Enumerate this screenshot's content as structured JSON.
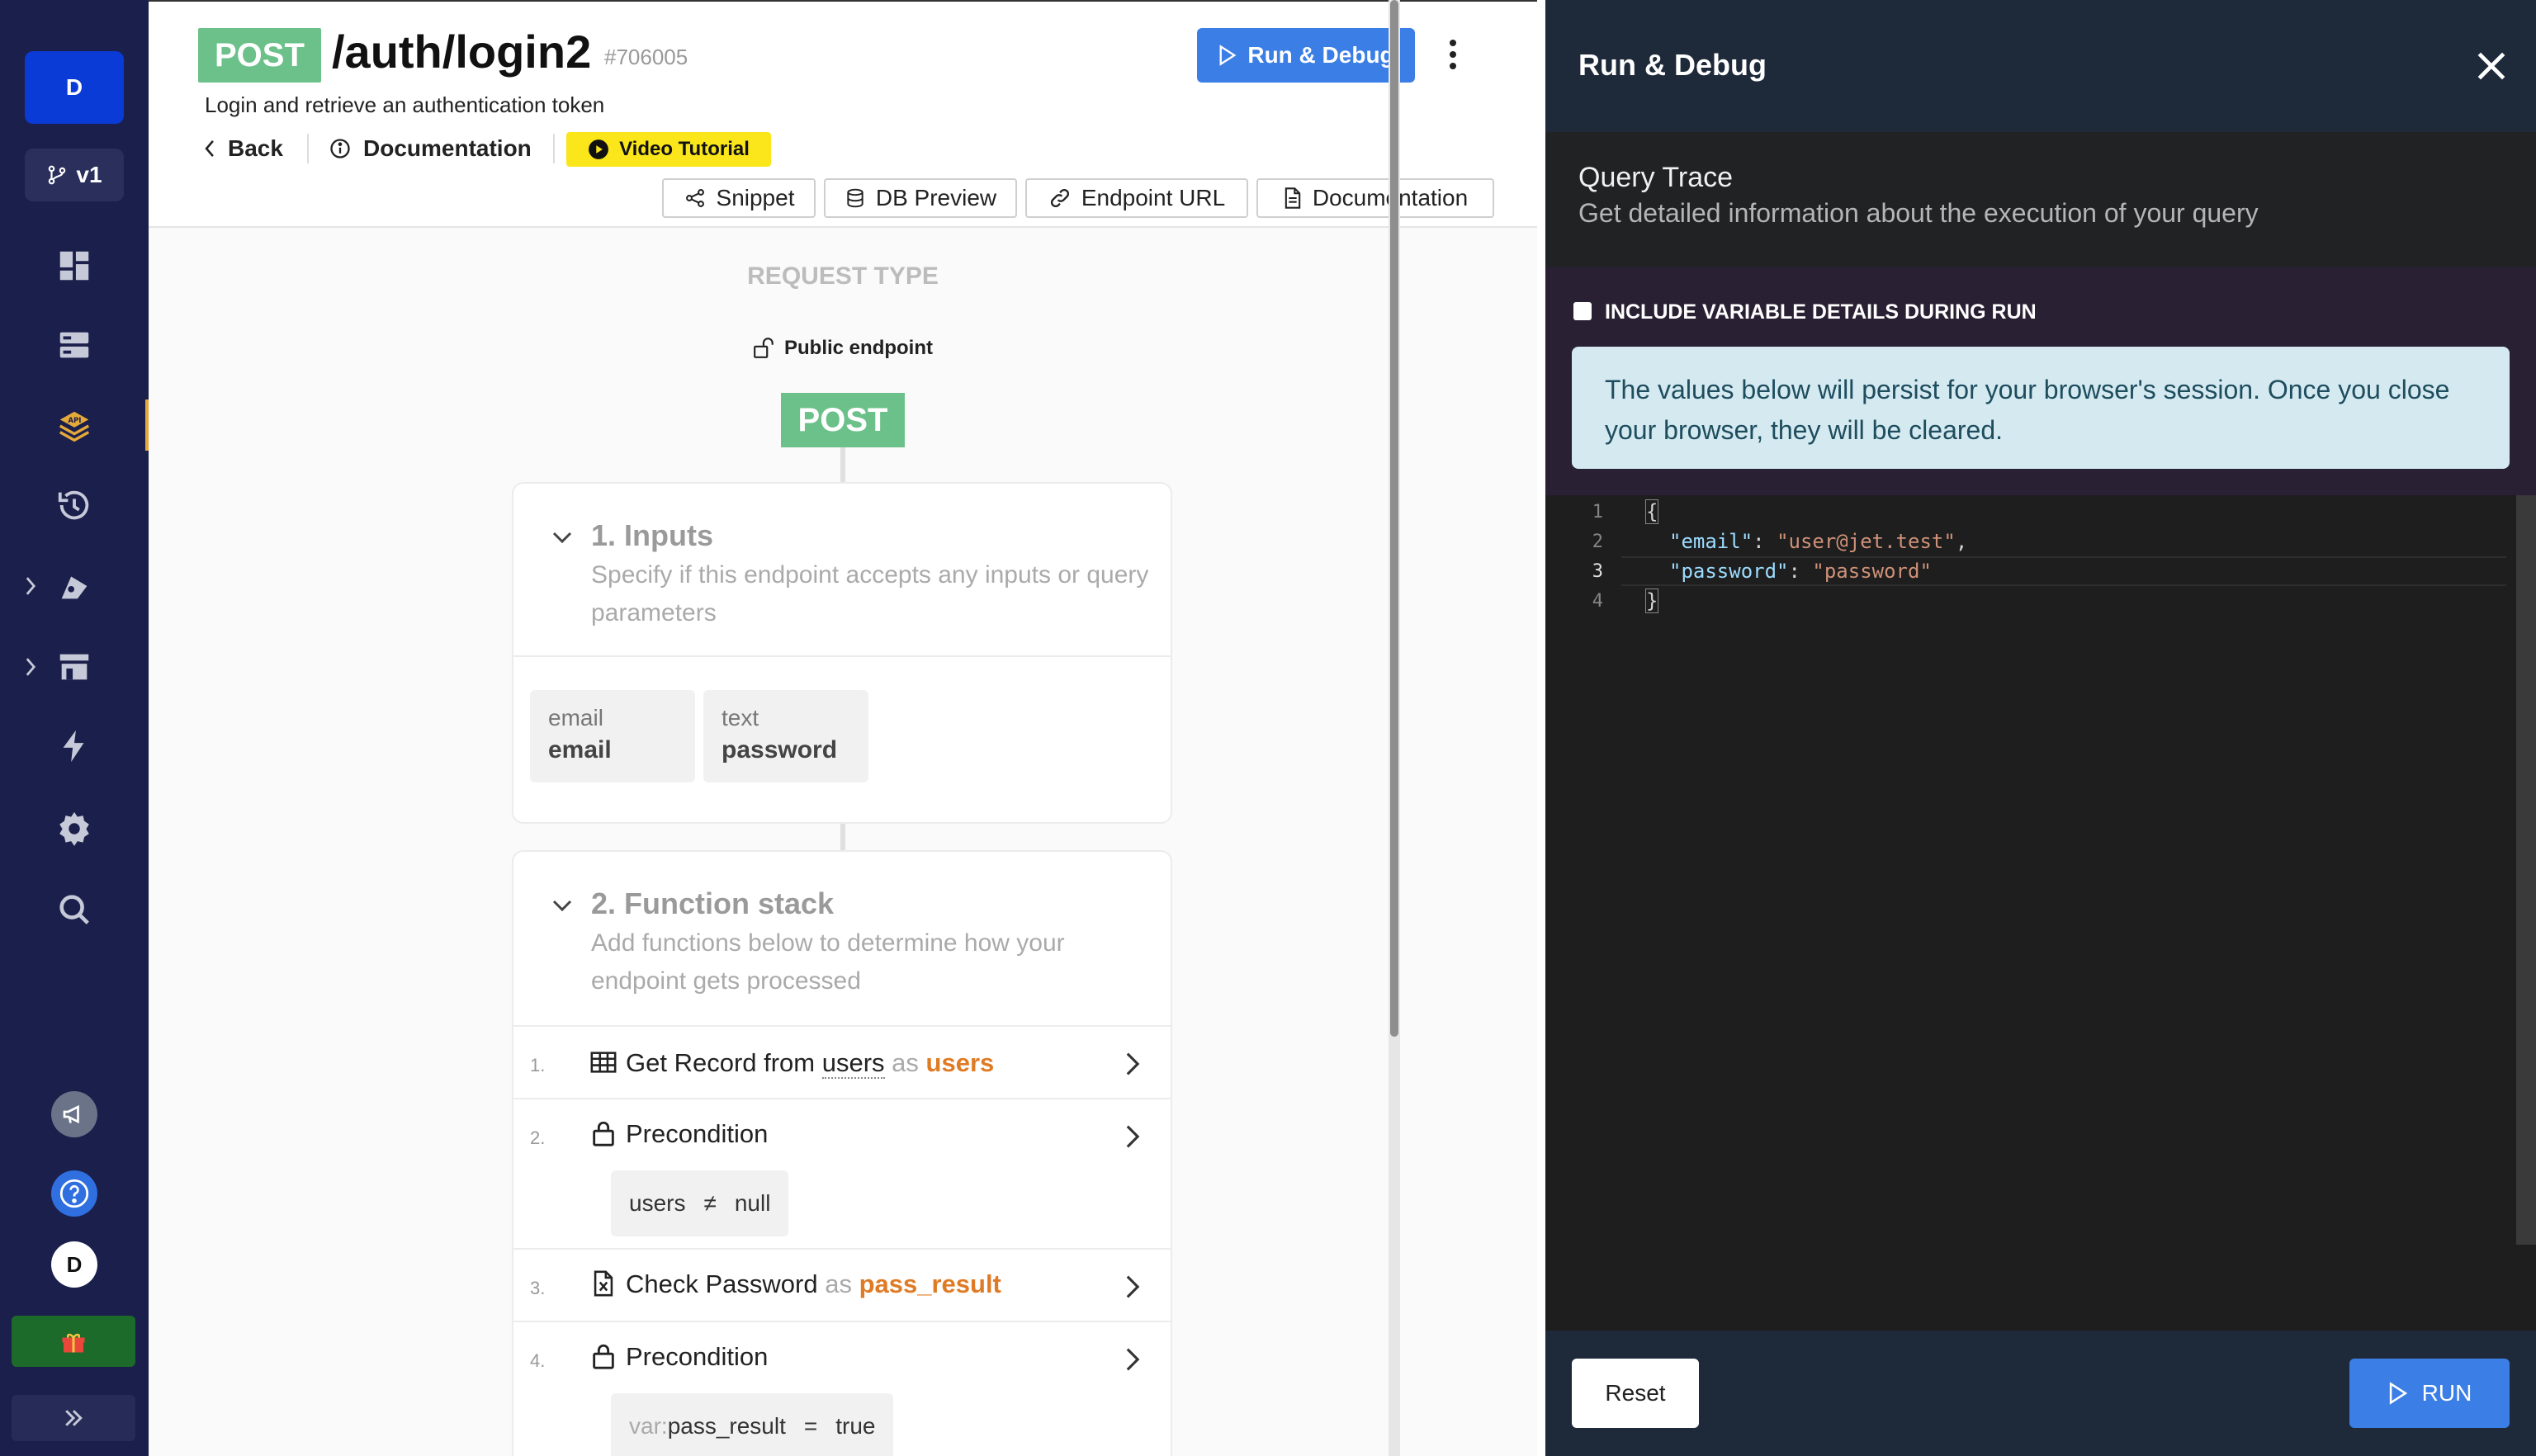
{
  "nav": {
    "workspace_initial": "D",
    "branch_label": "v1",
    "user_initial": "D",
    "items": [
      "dashboard-icon",
      "database-icon",
      "api-icon",
      "history-icon",
      "addons-icon",
      "marketplace-icon",
      "lightning-icon",
      "settings-icon",
      "search-icon"
    ]
  },
  "endpoint": {
    "method": "POST",
    "path": "/auth/login2",
    "id": "#706005",
    "description": "Login and retrieve an authentication token"
  },
  "header": {
    "run_debug_label": "Run & Debug",
    "back_label": "Back",
    "documentation_label": "Documentation",
    "video_label": "Video Tutorial",
    "toolbar": {
      "snippet": "Snippet",
      "db_preview": "DB Preview",
      "endpoint_url": "Endpoint URL",
      "documentation": "Documentation"
    }
  },
  "canvas": {
    "request_type_label": "REQUEST TYPE",
    "public_endpoint_label": "Public endpoint",
    "method_node": "POST",
    "inputs": {
      "title": "1. Inputs",
      "subtitle": "Specify if this endpoint accepts any inputs or query parameters",
      "items": [
        {
          "type": "email",
          "name": "email"
        },
        {
          "type": "text",
          "name": "password"
        }
      ]
    },
    "function_stack": {
      "title": "2. Function stack",
      "subtitle": "Add functions below to determine how your endpoint gets processed",
      "steps": [
        {
          "num": "1.",
          "pre": "Get Record from ",
          "table": "users",
          "as": " as ",
          "var": "users"
        },
        {
          "num": "2.",
          "label": "Precondition",
          "cond_left": "users",
          "cond_op": "≠",
          "cond_right": "null"
        },
        {
          "num": "3.",
          "label": "Check Password",
          "as": " as ",
          "var": "pass_result"
        },
        {
          "num": "4.",
          "label": "Precondition",
          "cond_prefix": "var:",
          "cond_left": "pass_result",
          "cond_op": "=",
          "cond_right": "true"
        }
      ]
    }
  },
  "panel": {
    "title": "Run & Debug",
    "trace_title": "Query Trace",
    "trace_sub": "Get detailed information about the execution of your query",
    "checkbox_label": "INCLUDE VARIABLE DETAILS DURING RUN",
    "info_text": "The values below will persist for your browser's session. Once you close your browser, they will be cleared.",
    "editor": {
      "line_numbers": [
        "1",
        "2",
        "3",
        "4"
      ],
      "open_brace": "{",
      "close_brace": "}",
      "email_key": "\"email\"",
      "email_value": "\"user@jet.test\"",
      "password_key": "\"password\"",
      "password_value": "\"password\""
    },
    "reset_label": "Reset",
    "run_label": "RUN"
  }
}
